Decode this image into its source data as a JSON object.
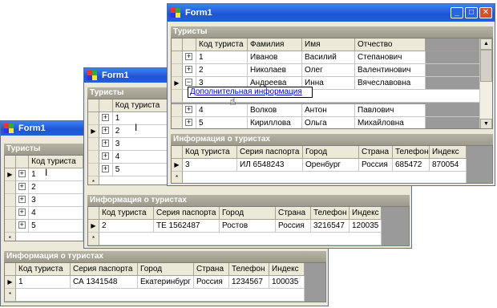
{
  "windows": {
    "title": "Form1",
    "caption_tourists": "Туристы",
    "caption_info": "Информация о туристах",
    "tourist_headers": [
      "Код туриста",
      "Фамилия",
      "Имя",
      "Отчество"
    ],
    "info_headers": [
      "Код туриста",
      "Серия паспорта",
      "Город",
      "Страна",
      "Телефон",
      "Индекс"
    ]
  },
  "tourists": [
    {
      "id": "1",
      "last": "Иванов",
      "first": "Василий",
      "middle": "Степанович"
    },
    {
      "id": "2",
      "last": "Николаев",
      "first": "Олег",
      "middle": "Валентинович"
    },
    {
      "id": "3",
      "last": "Андреева",
      "first": "Инна",
      "middle": "Вячеславовна"
    },
    {
      "id": "4",
      "last": "Волков",
      "first": "Антон",
      "middle": "Павлович"
    },
    {
      "id": "5",
      "last": "Кириллова",
      "first": "Ольга",
      "middle": "Михайловна"
    }
  ],
  "info_rows": {
    "win1": {
      "id": "1",
      "passport": "СА 1341548",
      "city": "Екатеринбург",
      "country": "Россия",
      "phone": "1234567",
      "index": "100035"
    },
    "win2": {
      "id": "2",
      "passport": "ТЕ 1562487",
      "city": "Ростов",
      "country": "Россия",
      "phone": "3216547",
      "index": "120035"
    },
    "win3": {
      "id": "3",
      "passport": "ИЛ 6548243",
      "city": "Оренбург",
      "country": "Россия",
      "phone": "685472",
      "index": "870054"
    }
  },
  "popup_link": "Дополнительная информация",
  "new_row_marker": "*",
  "current_row_marker": "▶",
  "expand_minus": "−",
  "expand_plus": "+",
  "titlebar_buttons": {
    "minimize": "_",
    "maximize": "□",
    "close": "✕"
  },
  "colors": {
    "titlebar": "#1c54d4",
    "caption": "#9d9a8b",
    "grid_bg": "#9a9a9a",
    "link": "#0000cc"
  }
}
